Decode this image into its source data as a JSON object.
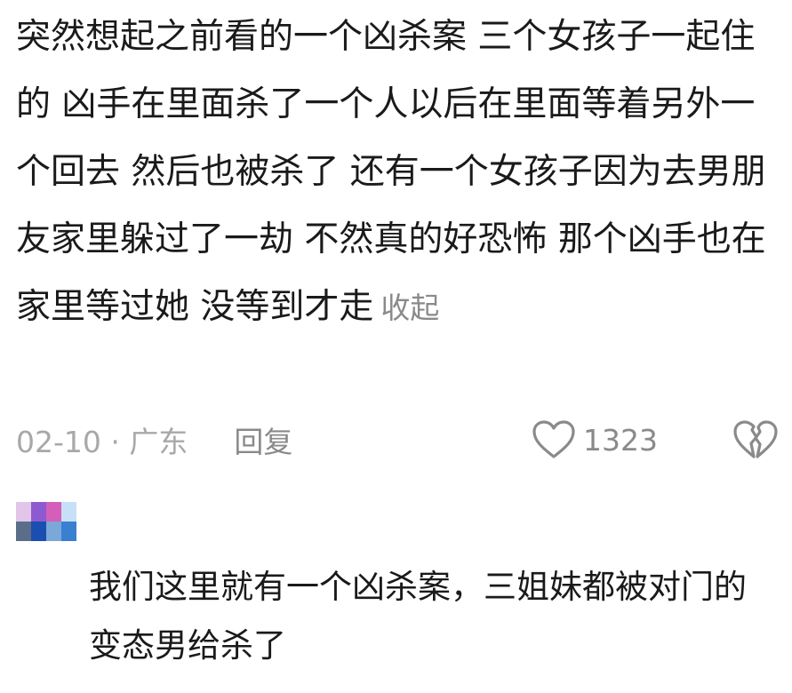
{
  "comment": {
    "text": "突然想起之前看的一个凶杀案 三个女孩子一起住的 凶手在里面杀了一个人以后在里面等着另外一个回去 然后也被杀了 还有一个女孩子因为去男朋友家里躲过了一劫 不然真的好恐怖 那个凶手也在家里等过她 没等到才走",
    "collapse_label": "收起",
    "date": "02-10",
    "location": "广东",
    "separator": " · ",
    "reply_label": "回复",
    "like_count": "1323",
    "icons": {
      "like": "heart-outline-icon",
      "dislike": "broken-heart-icon"
    }
  },
  "reply": {
    "avatar_colors": [
      "#e1c6ea",
      "#8d5ad0",
      "#d45fb8",
      "#c6e0f7",
      "#5a6e8a",
      "#1a4eb0",
      "#7aa8d8",
      "#3a7fd0"
    ],
    "text": "我们这里就有一个凶杀案，三姐妹都被对门的变态男给杀了"
  },
  "colors": {
    "text": "#1a1a1a",
    "muted": "#a8a8a8",
    "action": "#8a8a8a"
  }
}
